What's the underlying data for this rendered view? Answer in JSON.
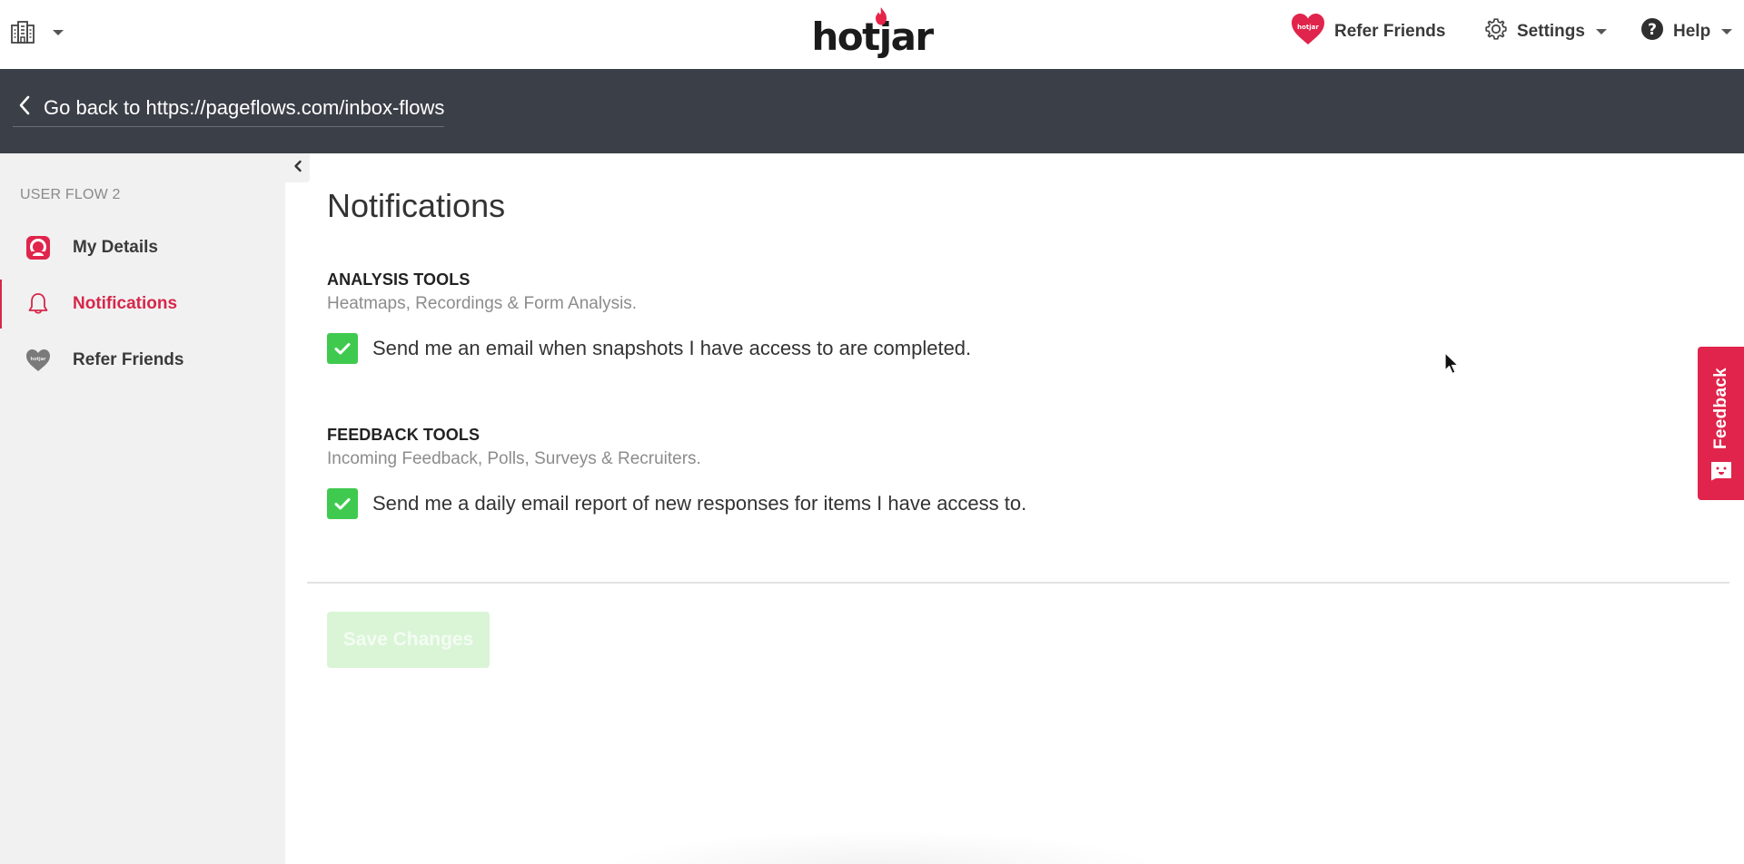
{
  "topbar": {
    "org_icon": "building-icon",
    "logo_text": "hotjar",
    "nav": {
      "refer_friends": "Refer Friends",
      "settings": "Settings",
      "help": "Help"
    }
  },
  "backbar": {
    "label": "Go back to https://pageflows.com/inbox-flows"
  },
  "sidebar": {
    "heading": "USER FLOW 2",
    "items": [
      {
        "label": "My Details",
        "icon": "user-icon",
        "active": false
      },
      {
        "label": "Notifications",
        "icon": "bell-icon",
        "active": true
      },
      {
        "label": "Refer Friends",
        "icon": "heart-icon",
        "active": false
      }
    ]
  },
  "main": {
    "title": "Notifications",
    "sections": [
      {
        "title": "ANALYSIS TOOLS",
        "subtitle": "Heatmaps, Recordings & Form Analysis.",
        "option": {
          "label": "Send me an email when snapshots I have access to are completed.",
          "checked": true
        }
      },
      {
        "title": "FEEDBACK TOOLS",
        "subtitle": "Incoming Feedback, Polls, Surveys & Recruiters.",
        "option": {
          "label": "Send me a daily email report of new responses for items I have access to.",
          "checked": true
        }
      }
    ],
    "save_label": "Save Changes"
  },
  "feedback_tab": {
    "label": "Feedback"
  },
  "colors": {
    "accent": "#d6274a",
    "checkbox": "#3fca4f",
    "backbar": "#3b3f47",
    "sidebar": "#f1f1f2",
    "save_disabled": "#d9f5d6"
  }
}
